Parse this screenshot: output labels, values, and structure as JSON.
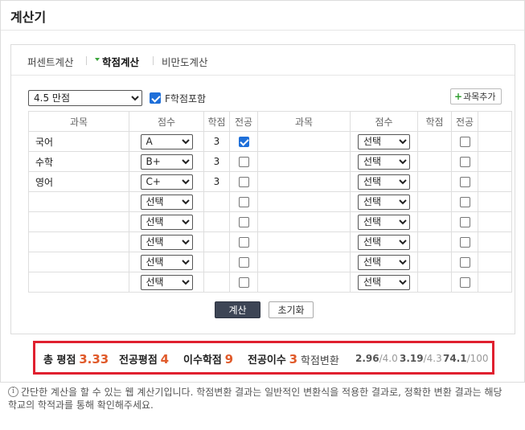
{
  "title": "계산기",
  "tabs": [
    {
      "label": "퍼센트계산",
      "active": false
    },
    {
      "label": "학점계산",
      "active": true
    },
    {
      "label": "비만도계산",
      "active": false
    }
  ],
  "controls": {
    "scale_value": "4.5 만점",
    "f_include_label": "F학점포함",
    "f_include_checked": true,
    "add_subject_label": "과목추가"
  },
  "table": {
    "headers": [
      "과목",
      "점수",
      "학점",
      "전공",
      "과목",
      "점수",
      "학점",
      "전공"
    ],
    "left_rows": [
      {
        "subject": "국어",
        "score": "A",
        "credit": "3",
        "major": true
      },
      {
        "subject": "수학",
        "score": "B+",
        "credit": "3",
        "major": false
      },
      {
        "subject": "영어",
        "score": "C+",
        "credit": "3",
        "major": false
      },
      {
        "subject": "",
        "score": "선택",
        "credit": "",
        "major": false
      },
      {
        "subject": "",
        "score": "선택",
        "credit": "",
        "major": false
      },
      {
        "subject": "",
        "score": "선택",
        "credit": "",
        "major": false
      },
      {
        "subject": "",
        "score": "선택",
        "credit": "",
        "major": false
      },
      {
        "subject": "",
        "score": "선택",
        "credit": "",
        "major": false
      }
    ],
    "right_rows": [
      {
        "subject": "",
        "score": "선택",
        "credit": "",
        "major": false
      },
      {
        "subject": "",
        "score": "선택",
        "credit": "",
        "major": false
      },
      {
        "subject": "",
        "score": "선택",
        "credit": "",
        "major": false
      },
      {
        "subject": "",
        "score": "선택",
        "credit": "",
        "major": false
      },
      {
        "subject": "",
        "score": "선택",
        "credit": "",
        "major": false
      },
      {
        "subject": "",
        "score": "선택",
        "credit": "",
        "major": false
      },
      {
        "subject": "",
        "score": "선택",
        "credit": "",
        "major": false
      },
      {
        "subject": "",
        "score": "선택",
        "credit": "",
        "major": false
      }
    ]
  },
  "buttons": {
    "calculate": "계산",
    "reset": "초기화"
  },
  "result": {
    "total_gpa_label": "총 평점",
    "total_gpa": "3.33",
    "major_gpa_label": "전공평점",
    "major_gpa": "4",
    "credits_label": "이수학점",
    "credits": "9",
    "major_credits_label": "전공이수",
    "major_credits": "3",
    "conversion_label": "학점변환",
    "conv_40": "2.96",
    "conv_40_max": "/4.0",
    "conv_43": "3.19",
    "conv_43_max": "/4.3",
    "conv_100": "74.1",
    "conv_100_max": "/100"
  },
  "note": {
    "line1": "간단한 계산을 할 수 있는 웹 계산기입니다. 학점변환 결과는 일반적인 변환식을 적용한 결과로, 정확한 변환 결과는 해당",
    "line2": "학교의 학적과를 통해 확인해주세요."
  },
  "colors": {
    "accent_orange": "#e05a2a",
    "highlight_red": "#e0202f",
    "checkbox_blue": "#1e6fd9",
    "calc_button_bg": "#3d4555"
  }
}
